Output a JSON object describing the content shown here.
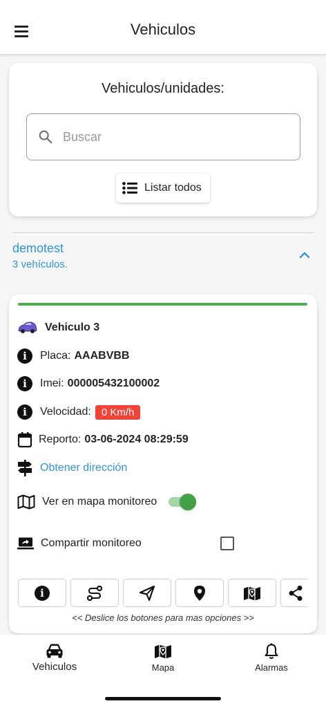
{
  "appbar": {
    "title": "Vehiculos"
  },
  "search": {
    "title": "Vehiculos/unidades:",
    "placeholder": "Buscar",
    "value": "",
    "list_all_label": "Listar todos"
  },
  "group": {
    "name": "demotest",
    "count_text": "3 vehículos."
  },
  "vehicle": {
    "name": "Vehiculo 3",
    "status_color": "#4caf50",
    "plate_label": "Placa:",
    "plate": "AAABVBB",
    "imei_label": "Imei:",
    "imei": "000005432100002",
    "speed_label": "Velocidad:",
    "speed": "0 Km/h",
    "speed_color": "#f44336",
    "report_label": "Reporto:",
    "report_datetime": "03-06-2024 08:29:59",
    "address_link": "Obtener dirección",
    "map_monitor_label": "Ver en mapa monitoreo",
    "map_monitor_on": true,
    "share_label": "Compartir monitoreo",
    "share_checked": false,
    "action_buttons": [
      "info-icon",
      "route-icon",
      "send-icon",
      "location-pin-icon",
      "map-icon",
      "share-icon"
    ],
    "scroll_hint": "<< Deslice los botones para mas opciones >>"
  },
  "bottom_nav": [
    {
      "label": "Vehiculos",
      "icon": "car-icon",
      "active": true
    },
    {
      "label": "Mapa",
      "icon": "map-icon",
      "active": false
    },
    {
      "label": "Alarmas",
      "icon": "bell-icon",
      "active": false
    }
  ],
  "colors": {
    "accent_link": "#2f95d6",
    "status_green": "#4caf50",
    "speed_red": "#f44336"
  }
}
